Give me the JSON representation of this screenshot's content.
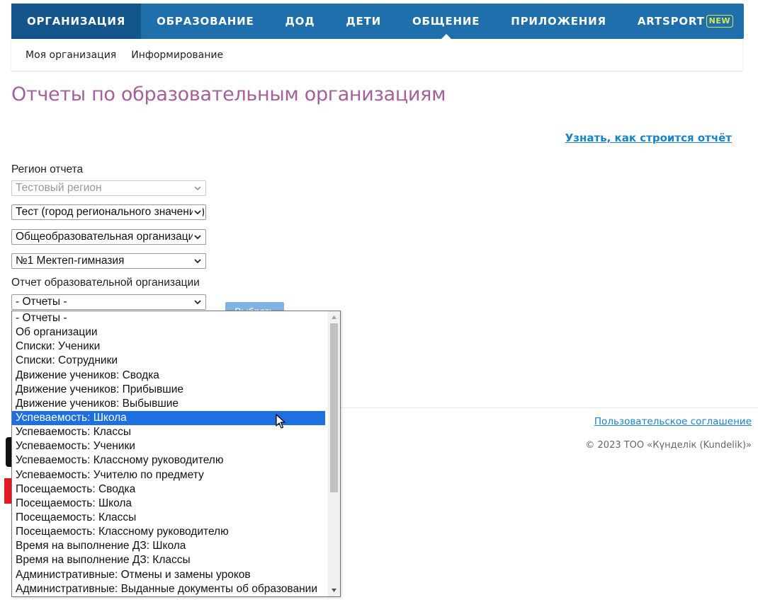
{
  "topnav": {
    "items": [
      {
        "label": "ОРГАНИЗАЦИЯ"
      },
      {
        "label": "ОБРАЗОВАНИЕ"
      },
      {
        "label": "ДОД"
      },
      {
        "label": "ДЕТИ"
      },
      {
        "label": "ОБЩЕНИЕ"
      },
      {
        "label": "ПРИЛОЖЕНИЯ"
      },
      {
        "label": "ARTSPORT",
        "badge": "NEW"
      }
    ]
  },
  "subnav": {
    "items": [
      {
        "label": "Моя организация"
      },
      {
        "label": "Информирование"
      }
    ]
  },
  "page": {
    "title": "Отчеты по образовательным организациям",
    "howto_link": "Узнать, как строится отчёт"
  },
  "form": {
    "region_label": "Регион отчета",
    "region_value": "Тестовый регион",
    "city_value": "Тест (город регионального значения)",
    "org_type_value": "Общеобразовательная организация",
    "school_value": "№1 Мектеп-гимназия",
    "report_label": "Отчет образовательной организации",
    "report_value": "- Отчеты -",
    "choose_button": "Выбрать"
  },
  "dropdown": {
    "options": [
      "- Отчеты -",
      "Об организации",
      "Списки: Ученики",
      "Списки: Сотрудники",
      "Движение учеников: Сводка",
      "Движение учеников: Прибывшие",
      "Движение учеников: Выбывшие",
      "Успеваемость: Школа",
      "Успеваемость: Классы",
      "Успеваемость: Ученики",
      "Успеваемость: Классному руководителю",
      "Успеваемость: Учителю по предмету",
      "Посещаемость: Сводка",
      "Посещаемость: Школа",
      "Посещаемость: Классы",
      "Посещаемость: Классному руководителю",
      "Время на выполнение ДЗ: Школа",
      "Время на выполнение ДЗ: Классы",
      "Административные: Отмены и замены уроков",
      "Административные: Выданные документы об образовании"
    ],
    "highlighted": "Успеваемость: Школа"
  },
  "footer": {
    "agreement_link": "Пользовательское соглашение",
    "copyright": "© 2023 ТОО «Күнделік (Kundelik)»"
  },
  "colors": {
    "nav_bg": "#1f6fad",
    "nav_active": "#14568c",
    "title": "#a3609a",
    "link": "#1a83c5",
    "highlight": "#1e6fe0"
  }
}
